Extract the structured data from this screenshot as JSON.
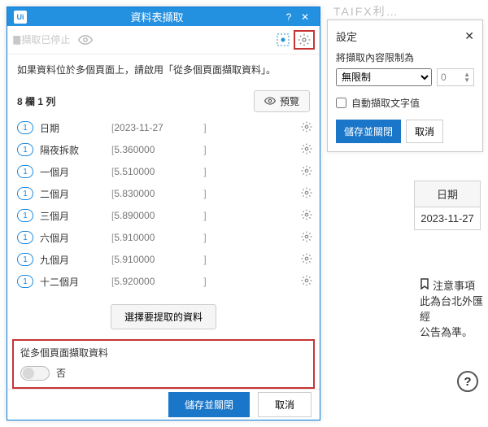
{
  "titlebar": {
    "logo": "Ui",
    "title": "資料表擷取"
  },
  "toolbar": {
    "pause_text": "擷取已停止"
  },
  "hint": "如果資料位於多個頁面上，請啟用「從多個頁面擷取資料」。",
  "list": {
    "count_label": "8 欄 1 列",
    "preview_label": "預覽",
    "rows": [
      {
        "index": "1",
        "name": "日期",
        "value": "2023-11-27"
      },
      {
        "index": "1",
        "name": "隔夜拆款",
        "value": "5.360000"
      },
      {
        "index": "1",
        "name": "一個月",
        "value": "5.510000"
      },
      {
        "index": "1",
        "name": "二個月",
        "value": "5.830000"
      },
      {
        "index": "1",
        "name": "三個月",
        "value": "5.890000"
      },
      {
        "index": "1",
        "name": "六個月",
        "value": "5.910000"
      },
      {
        "index": "1",
        "name": "九個月",
        "value": "5.910000"
      },
      {
        "index": "1",
        "name": "十二個月",
        "value": "5.920000"
      }
    ]
  },
  "select_data_btn": "選擇要提取的資料",
  "multi": {
    "label": "從多個頁面擷取資料",
    "value_label": "否"
  },
  "footer": {
    "save": "儲存並關閉",
    "cancel": "取消"
  },
  "settings": {
    "title": "設定",
    "limit_label": "將擷取內容限制為",
    "limit_select": "無限制",
    "spin_value": "0",
    "auto_text": "自動擷取文字值",
    "save": "儲存並關閉",
    "cancel": "取消"
  },
  "bg_title": "TAIFX利…",
  "date_panel": {
    "header": "日期",
    "value": "2023-11-27"
  },
  "notice": {
    "header": "注意事項",
    "line1": "此為台北外匯經",
    "line2": "公告為準。"
  }
}
